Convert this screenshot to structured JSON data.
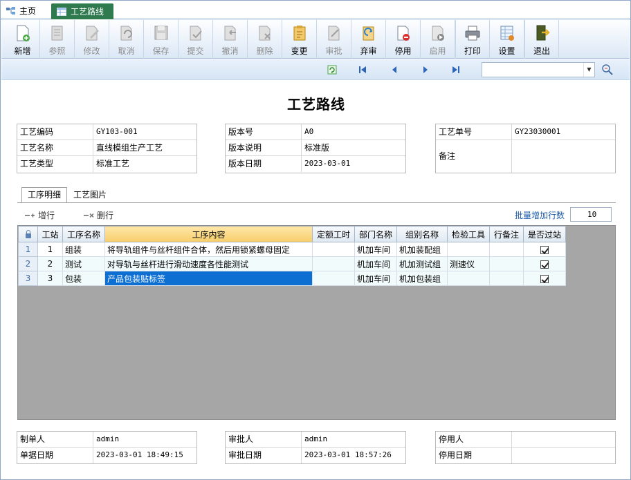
{
  "tabs": {
    "home": "主页",
    "active": "工艺路线"
  },
  "toolbar": [
    {
      "key": "new",
      "label": "新增",
      "enabled": true
    },
    {
      "key": "ref",
      "label": "参照",
      "enabled": false
    },
    {
      "key": "edit",
      "label": "修改",
      "enabled": false
    },
    {
      "key": "cancel",
      "label": "取消",
      "enabled": false
    },
    {
      "key": "save",
      "label": "保存",
      "enabled": false
    },
    {
      "key": "submit",
      "label": "提交",
      "enabled": false
    },
    {
      "key": "revoke",
      "label": "撤消",
      "enabled": false
    },
    {
      "key": "delete",
      "label": "删除",
      "enabled": false
    },
    {
      "key": "change",
      "label": "变更",
      "enabled": true
    },
    {
      "key": "approve",
      "label": "审批",
      "enabled": false
    },
    {
      "key": "abandon",
      "label": "弃审",
      "enabled": true
    },
    {
      "key": "disable",
      "label": "停用",
      "enabled": true
    },
    {
      "key": "enable",
      "label": "启用",
      "enabled": false
    },
    {
      "key": "print",
      "label": "打印",
      "enabled": true
    },
    {
      "key": "settings",
      "label": "设置",
      "enabled": true
    },
    {
      "key": "exit",
      "label": "退出",
      "enabled": true
    }
  ],
  "page_title": "工艺路线",
  "box1": {
    "code_label": "工艺编码",
    "code": "GY103-001",
    "name_label": "工艺名称",
    "name": "直线模组生产工艺",
    "type_label": "工艺类型",
    "type": "标准工艺"
  },
  "box2": {
    "ver_label": "版本号",
    "ver": "A0",
    "desc_label": "版本说明",
    "desc": "标准版",
    "date_label": "版本日期",
    "date": "2023-03-01"
  },
  "box3": {
    "no_label": "工艺单号",
    "no": "GY23030001",
    "remark_label": "备注",
    "remark": ""
  },
  "inner_tabs": {
    "detail": "工序明细",
    "image": "工艺图片"
  },
  "sub_toolbar": {
    "add": "增行",
    "del": "删行",
    "batch_label": "批量增加行数",
    "batch_value": "10"
  },
  "grid": {
    "headers": [
      "工站",
      "工序名称",
      "工序内容",
      "定额工时",
      "部门名称",
      "组别名称",
      "检验工具",
      "行备注",
      "是否过站"
    ],
    "rows": [
      {
        "rn": "1",
        "station": "1",
        "name": "组装",
        "content": "将导轨组件与丝杆组件合体，然后用锁紧螺母固定",
        "hours": "",
        "dept": "机加车间",
        "group": "机加装配组",
        "tool": "",
        "remark": "",
        "pass": true
      },
      {
        "rn": "2",
        "station": "2",
        "name": "测试",
        "content": "对导轨与丝杆进行滑动速度各性能测试",
        "hours": "",
        "dept": "机加车间",
        "group": "机加测试组",
        "tool": "测速仪",
        "remark": "",
        "pass": true
      },
      {
        "rn": "3",
        "station": "3",
        "name": "包装",
        "content": "产品包装贴标签",
        "hours": "",
        "dept": "机加车间",
        "group": "机加包装组",
        "tool": "",
        "remark": "",
        "pass": true
      }
    ]
  },
  "footer1": {
    "maker_label": "制单人",
    "maker": "admin",
    "date_label": "单据日期",
    "date": "2023-03-01 18:49:15"
  },
  "footer2": {
    "approver_label": "审批人",
    "approver": "admin",
    "date_label": "审批日期",
    "date": "2023-03-01 18:57:26"
  },
  "footer3": {
    "disabler_label": "停用人",
    "disabler": "",
    "date_label": "停用日期",
    "date": ""
  }
}
